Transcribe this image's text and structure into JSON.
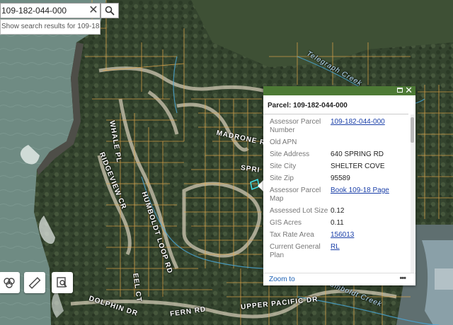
{
  "search": {
    "value": "109-182-044-000",
    "clear_glyph": "✕",
    "suggestion": "Show search results for 109-18..."
  },
  "map_labels": {
    "madrone": "MADRONE R",
    "spring": "SPRI",
    "whale": "WHALE PL",
    "ridgeview": "RIDGEVIEW CR",
    "humboldt_loop": "HUMBOLDT LOOP RD",
    "eel": "EEL CT",
    "dolphin": "DOLPHIN DR",
    "upper_pacific": "UPPER PACIFIC DR",
    "humboldt_creek": "Humboldt Creek",
    "telegraph_creek": "Telegraph Creek",
    "fern": "FERN RD"
  },
  "popup": {
    "title": "Parcel: 109-182-044-000",
    "rows": [
      {
        "label": "Assessor Parcel Number",
        "value": "109-182-044-000"
      },
      {
        "label": "Old APN",
        "value": ""
      },
      {
        "label": "Site Address",
        "value": "640 SPRING RD"
      },
      {
        "label": "Site City",
        "value": "SHELTER COVE"
      },
      {
        "label": "Site Zip",
        "value": "95589"
      },
      {
        "label": "Assessor Parcel Map",
        "value": "Book 109-18 Page"
      },
      {
        "label": "Assessed Lot Size",
        "value": "0.12"
      },
      {
        "label": "GIS Acres",
        "value": "0.11"
      },
      {
        "label": "Tax Rate Area",
        "value": "156013"
      },
      {
        "label": "Current General Plan",
        "value": "RL"
      }
    ],
    "zoom_label": "Zoom to",
    "more_label": "•••",
    "close_glyph": "✕"
  },
  "colors": {
    "header_green": "#4d7a35",
    "parcel_line": "#e6a84a",
    "selected_parcel": "#40e0e8",
    "creek": "#4aa8d8",
    "ocean": "#6e8a82"
  }
}
